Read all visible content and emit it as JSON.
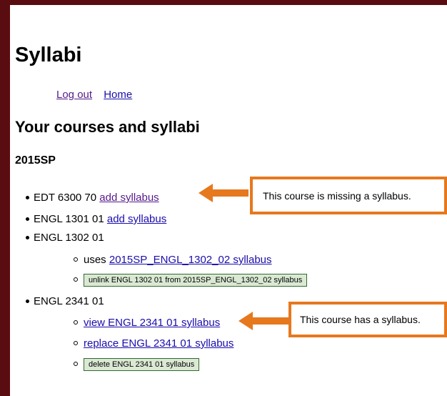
{
  "page": {
    "title": "Syllabi",
    "nav": {
      "logout": "Log out",
      "home": "Home"
    },
    "heading": "Your courses and syllabi",
    "term": "2015SP"
  },
  "courses": [
    {
      "code": "EDT 6300 70",
      "link": "add syllabus"
    },
    {
      "code": "ENGL 1301 01",
      "link": "add syllabus"
    },
    {
      "code": "ENGL 1302 01",
      "uses_prefix": "uses",
      "uses_link": "2015SP_ENGL_1302_02 syllabus",
      "unlink_button": "unlink ENGL 1302 01 from 2015SP_ENGL_1302_02 syllabus"
    },
    {
      "code": "ENGL 2341 01",
      "view_link": "view ENGL 2341 01 syllabus",
      "replace_link": "replace ENGL 2341 01 syllabus",
      "delete_button": "delete ENGL 2341 01 syllabus"
    }
  ],
  "callouts": {
    "missing": "This course is missing a syllabus.",
    "has": "This course has a syllabus."
  },
  "colors": {
    "frame": "#5a0d10",
    "link": "#1a0dab",
    "visited_link": "#551a8b",
    "callout_border": "#e6781e",
    "button_bg": "#dbe9d4",
    "button_border": "#2f6b2f"
  }
}
